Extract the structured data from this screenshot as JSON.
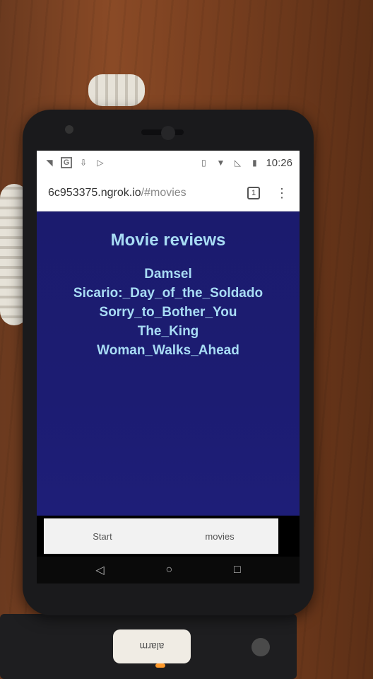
{
  "statusbar": {
    "time": "10:26",
    "left_icons": [
      "wifi-question-icon",
      "google-icon",
      "download-icon",
      "play-store-icon"
    ],
    "right_icons": [
      "vibrate-icon",
      "wifi-icon",
      "no-signal-icon",
      "battery-charging-icon"
    ]
  },
  "browser": {
    "url_host": "6c953375.ngrok.io",
    "url_path": "/#movies",
    "tab_count": "1"
  },
  "page": {
    "title": "Movie reviews",
    "movies": [
      "Damsel",
      "Sicario:_Day_of_the_Soldado",
      "Sorry_to_Bother_You",
      "The_King",
      "Woman_Walks_Ahead"
    ]
  },
  "bottom_nav": {
    "start_label": "Start",
    "movies_label": "movies"
  },
  "device": {
    "alarm_label": "alarm"
  }
}
